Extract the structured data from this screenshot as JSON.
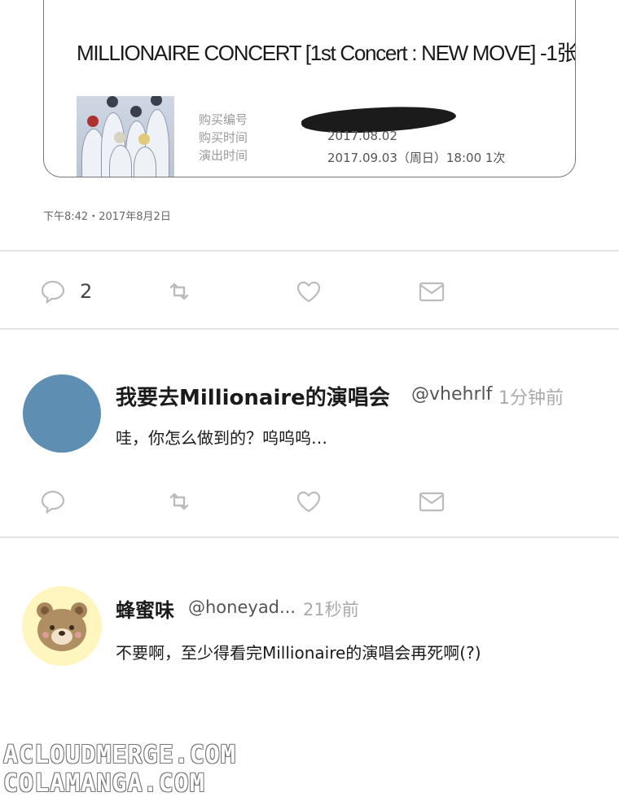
{
  "ticket": {
    "title": "MILLIONAIRE CONCERT [1st Concert : NEW MOVE] -1张",
    "labels": {
      "order_no": "购买编号",
      "purchase_time": "购买时间",
      "show_time": "演出时间"
    },
    "values": {
      "purchase_time": "2017.08.02",
      "show_time": "2017.09.03（周日）18:00 1次"
    }
  },
  "post": {
    "timestamp": "下午8:42・2017年8月2日",
    "reply_count": "2"
  },
  "replies": [
    {
      "name": "我要去Millionaire的演唱会",
      "handle": "@vhehrlf",
      "time": "1分钟前",
      "text": "哇，你怎么做到的？呜呜呜…",
      "avatar_color": "#5e8fb3"
    },
    {
      "name": "蜂蜜味",
      "handle": "@honeyad...",
      "time": "21秒前",
      "text": "不要啊，至少得看完Millionaire的演唱会再死啊(?)",
      "avatar_color": "#fff6bf",
      "avatar_icon": "bear-face-icon"
    }
  ],
  "icons": [
    "reply-icon",
    "retweet-icon",
    "like-icon",
    "message-icon"
  ],
  "watermark": {
    "line1": "ACLOUDMERGE.COM",
    "line2": "COLAMANGA.COM"
  }
}
